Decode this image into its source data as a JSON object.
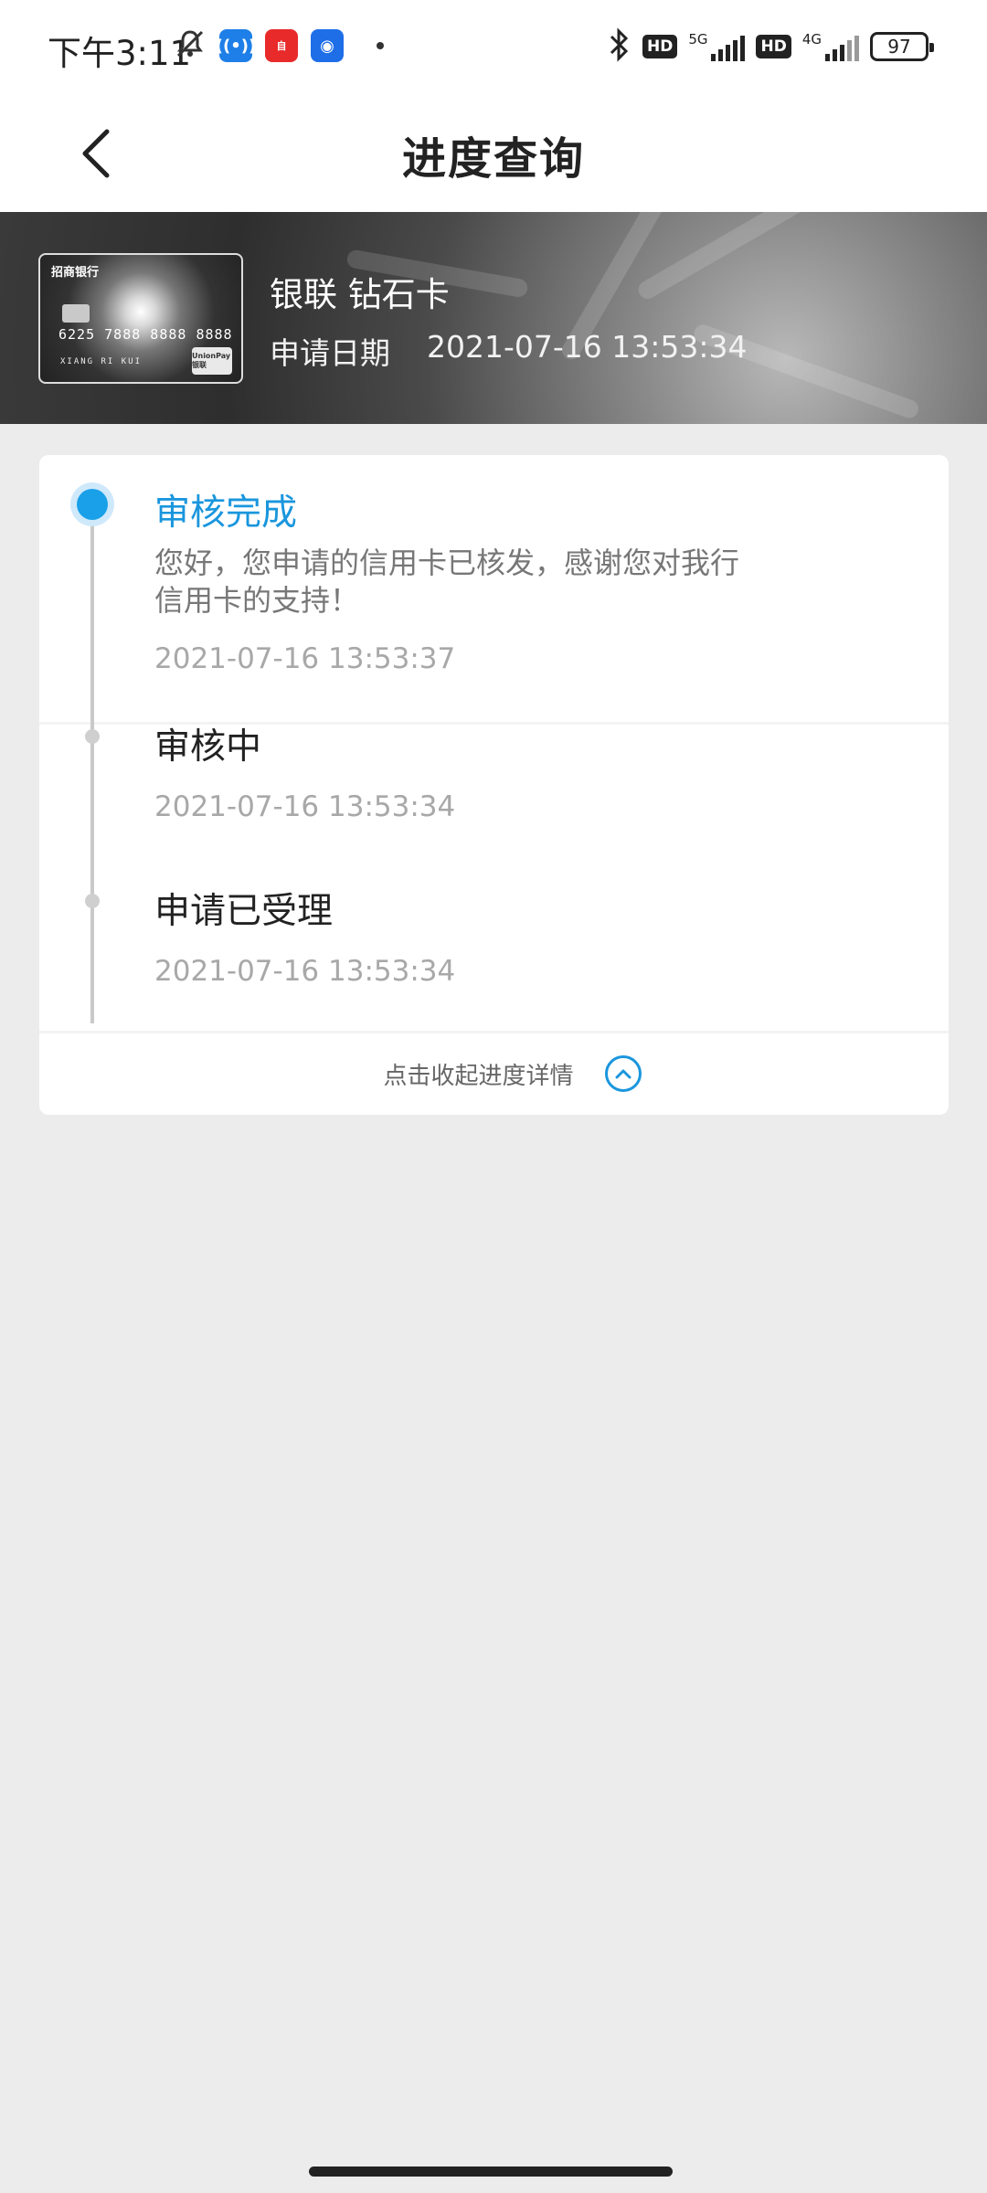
{
  "status_bar": {
    "time": "下午3:11",
    "network_5g": "5G",
    "network_4g": "4G",
    "hd": "HD",
    "battery": "97",
    "icons": [
      "mute-bell-icon",
      "app-icon-blue",
      "app-icon-red",
      "app-icon-baidu",
      "bluetooth-icon"
    ]
  },
  "nav": {
    "title": "进度查询",
    "back_icon": "chevron-left-icon"
  },
  "card": {
    "name": "银联 钻石卡",
    "date_label": "申请日期",
    "date_value": "2021-07-16 13:53:34",
    "image": {
      "bank": "招商银行",
      "number": "6225 7888 8888 8888",
      "holder": "XIANG RI KUI",
      "network": "UnionPay 银联"
    }
  },
  "progress": {
    "steps": [
      {
        "title": "审核完成",
        "desc": "您好，您申请的信用卡已核发，感谢您对我行信用卡的支持！",
        "time": "2021-07-16 13:53:37",
        "active": true
      },
      {
        "title": "审核中",
        "time": "2021-07-16 13:53:34",
        "active": false
      },
      {
        "title": "申请已受理",
        "time": "2021-07-16 13:53:34",
        "active": false
      }
    ],
    "collapse_label": "点击收起进度详情",
    "collapse_icon": "chevron-up-circle-icon"
  },
  "colors": {
    "accent": "#1a96dd",
    "background": "#ececec"
  }
}
